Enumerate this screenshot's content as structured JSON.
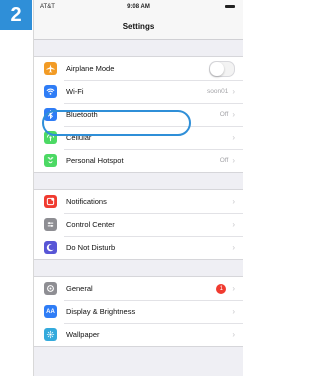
{
  "step": "2",
  "status": {
    "carrier": "AT&T",
    "time": "9:08 AM"
  },
  "nav": {
    "title": "Settings"
  },
  "groups": [
    [
      {
        "label": "Airplane Mode",
        "icon": "airplane-icon",
        "color": "#f29b25",
        "control": "toggle",
        "toggle_on": false
      },
      {
        "label": "Wi-Fi",
        "icon": "wifi-icon",
        "color": "#2f7df6",
        "value": "soon01"
      },
      {
        "label": "Bluetooth",
        "icon": "bluetooth-icon",
        "color": "#2f7df6",
        "value": "Off"
      },
      {
        "label": "Cellular",
        "icon": "cellular-icon",
        "color": "#4cd964"
      },
      {
        "label": "Personal Hotspot",
        "icon": "hotspot-icon",
        "color": "#4cd964",
        "value": "Off"
      }
    ],
    [
      {
        "label": "Notifications",
        "icon": "notifications-icon",
        "color": "#f03b30"
      },
      {
        "label": "Control Center",
        "icon": "control-center-icon",
        "color": "#8e8e93"
      },
      {
        "label": "Do Not Disturb",
        "icon": "moon-icon",
        "color": "#5856d6"
      }
    ],
    [
      {
        "label": "General",
        "icon": "gear-icon",
        "color": "#8e8e93",
        "badge": "1",
        "badge_color": "#f03b30"
      },
      {
        "label": "Display & Brightness",
        "icon": "display-brightness-icon",
        "color": "#2f7df6"
      },
      {
        "label": "Wallpaper",
        "icon": "wallpaper-icon",
        "color": "#34aadc"
      }
    ]
  ],
  "highlight_color": "#2f8fd8"
}
